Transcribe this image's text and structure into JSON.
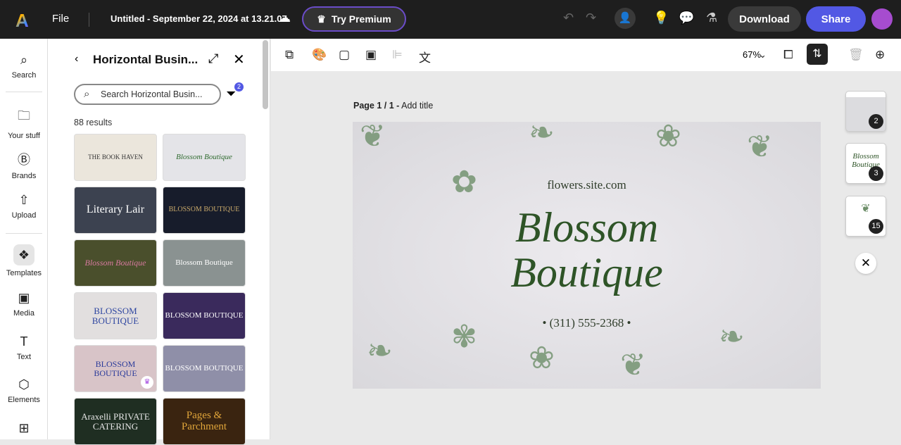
{
  "topbar": {
    "file": "File",
    "title": "Untitled - September 22, 2024 at 13.21.07",
    "premium": "Try Premium",
    "download": "Download",
    "share": "Share"
  },
  "rail": [
    {
      "label": "Search",
      "icon": "search-icon"
    },
    {
      "label": "Your stuff",
      "icon": "folder-icon"
    },
    {
      "label": "Brands",
      "icon": "brand-icon"
    },
    {
      "label": "Upload",
      "icon": "upload-icon"
    },
    {
      "label": "Templates",
      "icon": "templates-icon"
    },
    {
      "label": "Media",
      "icon": "media-icon"
    },
    {
      "label": "Text",
      "icon": "text-icon"
    },
    {
      "label": "Elements",
      "icon": "elements-icon"
    }
  ],
  "panel": {
    "title": "Horizontal Busin...",
    "search_placeholder": "Search Horizontal Busin...",
    "filter_count": "2",
    "results": "88 results",
    "templates": [
      {
        "text": "THE BOOK HAVEN"
      },
      {
        "text": "Blossom Boutique"
      },
      {
        "text": "Literary Lair"
      },
      {
        "text": "BLOSSOM BOUTIQUE"
      },
      {
        "text": "Blossom Boutique"
      },
      {
        "text": "Blossom Boutique"
      },
      {
        "text": "BLOSSOM BOUTIQUE"
      },
      {
        "text": "BLOSSOM BOUTIQUE"
      },
      {
        "text": "BLOSSOM BOUTIQUE",
        "premium": true
      },
      {
        "text": "BLOSSOM BOUTIQUE"
      },
      {
        "text": "Araxelli PRIVATE CATERING"
      },
      {
        "text": "Pages & Parchment"
      }
    ]
  },
  "toolbar": {
    "zoom": "67%"
  },
  "canvas": {
    "page_label": "Page 1 / 1 -",
    "add_title": "Add title",
    "site": "flowers.site.com",
    "line1": "Blossom",
    "line2": "Boutique",
    "phone": "• (311) 555-2368 •"
  },
  "pages": [
    {
      "count": "2",
      "caption": ""
    },
    {
      "count": "3",
      "caption": "Blossom Boutique"
    },
    {
      "count": "15",
      "caption": ""
    }
  ]
}
